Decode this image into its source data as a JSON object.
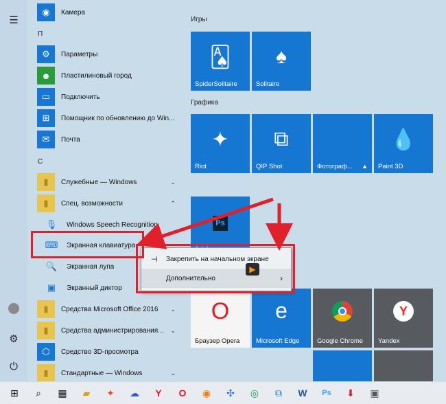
{
  "rail": {
    "menu_icon": "hamburger-icon",
    "avatar_icon": "avatar",
    "settings_icon": "gear-icon",
    "power_icon": "power-icon"
  },
  "applist": {
    "headers": [
      "П",
      "С"
    ],
    "items": [
      {
        "label": "Камера",
        "icon": "camera-icon"
      },
      {
        "label": "Параметры",
        "icon": "gear-icon"
      },
      {
        "label": "Пластилиновый город",
        "icon": "game-icon"
      },
      {
        "label": "Подключить",
        "icon": "connect-icon"
      },
      {
        "label": "Помощник по обновлению до Win...",
        "icon": "windows-icon"
      },
      {
        "label": "Почта",
        "icon": "mail-icon"
      },
      {
        "label": "Служебные — Windows",
        "icon": "folder-icon",
        "chevron": "⌄"
      },
      {
        "label": "Спец. возможности",
        "icon": "folder-icon",
        "chevron": "⌃"
      },
      {
        "label": "Windows Speech Recognition",
        "icon": "microphone-icon"
      },
      {
        "label": "Экранная клавиатура",
        "icon": "keyboard-icon"
      },
      {
        "label": "Экранная лупа",
        "icon": "magnifier-icon"
      },
      {
        "label": "Экранный диктор",
        "icon": "narrator-icon"
      },
      {
        "label": "Средства Microsoft Office 2016",
        "icon": "folder-icon",
        "chevron": "⌄"
      },
      {
        "label": "Средства администрирования...",
        "icon": "folder-icon",
        "chevron": "⌄"
      },
      {
        "label": "Средство 3D-просмотра",
        "icon": "cube-icon"
      },
      {
        "label": "Стандартные — Windows",
        "icon": "folder-icon",
        "chevron": "⌄"
      }
    ]
  },
  "tiles": {
    "group_games": "Игры",
    "group_graphics": "Графика",
    "spider": "SpiderSolitaire",
    "solitaire": "Solitaire",
    "riot": "Riot",
    "qip": "QIP Shot",
    "photo": "Фотограф...",
    "paint3d": "Paint 3D",
    "adobe": "Adobe ...",
    "opera": "Браузер Opera",
    "edge": "Microsoft Edge",
    "chrome": "Google Chrome",
    "yandex": "Yandex"
  },
  "context_menu": {
    "pin": "Закрепить на начальном экране",
    "more": "Дополнительно"
  },
  "colors": {
    "accent": "#1677d3",
    "highlight": "#e0202a"
  }
}
